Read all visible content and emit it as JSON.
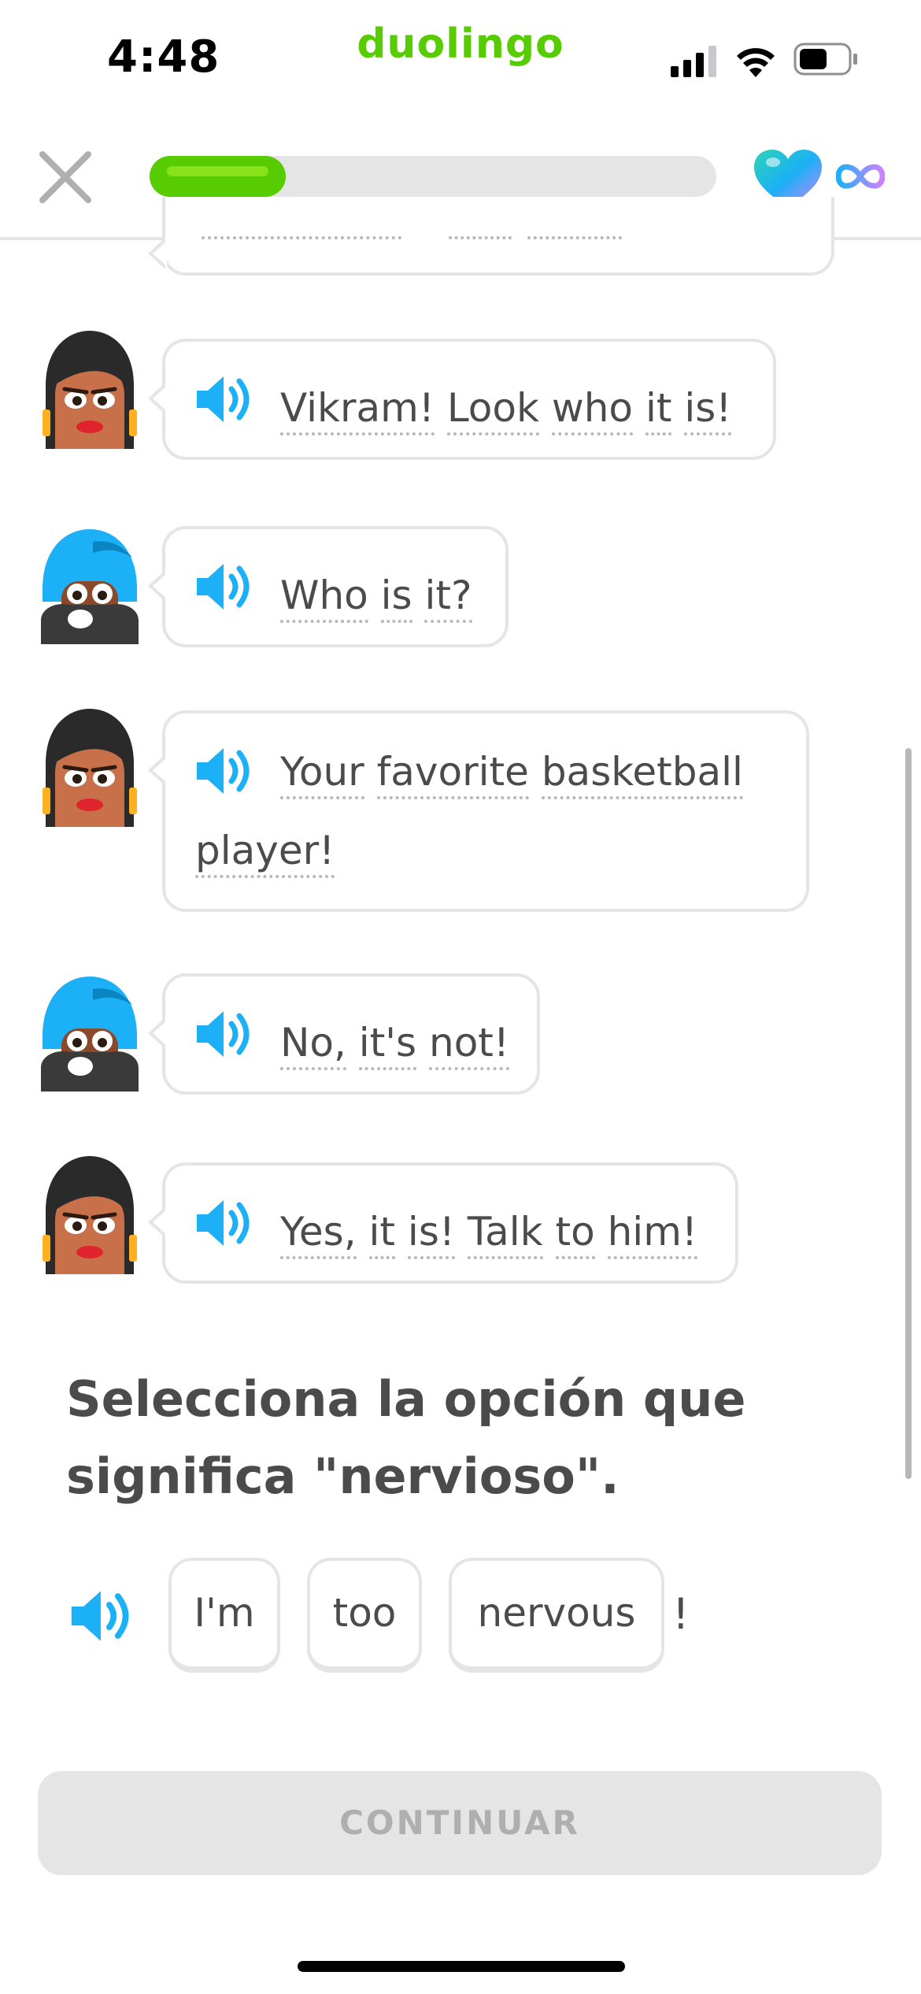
{
  "status_bar": {
    "time": "4:48",
    "brand": "duolingo",
    "icons": [
      "cellular-signal-icon",
      "wifi-icon",
      "battery-icon"
    ]
  },
  "header": {
    "close_icon": "close-icon",
    "progress_fraction": 0.24,
    "hearts_icon": "heart-gem-icon",
    "hearts_value_icon": "infinity-icon"
  },
  "colors": {
    "brand_green": "#58cc02",
    "speaker_blue": "#1cb0f6",
    "border_gray": "#e5e5e5",
    "text_gray": "#4b4b4b",
    "disabled_text": "#afafaf"
  },
  "chat": [
    {
      "speaker": "woman",
      "words": [
        "Vikram!",
        "Look",
        "who",
        "it",
        "is!"
      ]
    },
    {
      "speaker": "man",
      "words": [
        "Who",
        "is",
        "it?"
      ]
    },
    {
      "speaker": "woman",
      "words": [
        "Your",
        "favorite",
        "basketball",
        "player!"
      ]
    },
    {
      "speaker": "man",
      "words": [
        "No,",
        "it's",
        "not!"
      ]
    },
    {
      "speaker": "woman",
      "words": [
        "Yes,",
        "it",
        "is!",
        "Talk",
        "to",
        "him!"
      ]
    }
  ],
  "prompt": {
    "text": "Selecciona la opción que significa \"nervioso\"."
  },
  "answer": {
    "options": [
      "I'm",
      "too",
      "nervous"
    ],
    "trailing": "!"
  },
  "footer": {
    "continue_label": "CONTINUAR"
  }
}
